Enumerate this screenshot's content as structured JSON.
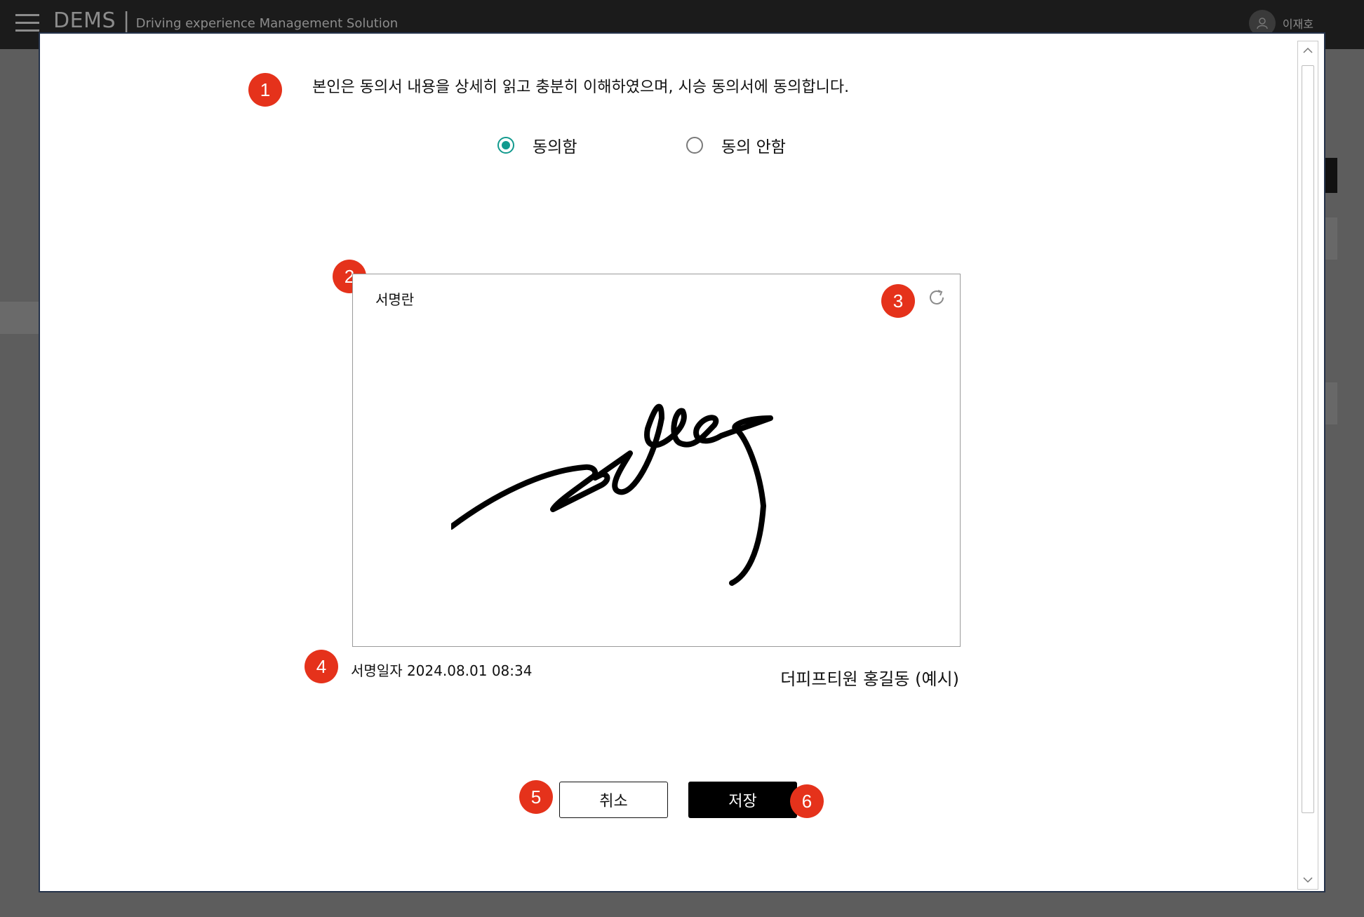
{
  "header": {
    "brand": "DEMS |",
    "brand_sub": "Driving experience Management Solution",
    "user_name": "이재호"
  },
  "modal": {
    "consent_text": "본인은 동의서 내용을 상세히 읽고 충분히 이해하였으며,  시승 동의서에 동의합니다.",
    "radio_agree": "동의함",
    "radio_disagree": "동의 안함",
    "selected": "agree",
    "signature_label": "서명란",
    "signature_date": "서명일자 2024.08.01  08:34",
    "signer": "더피프티원 홍길동 (예시)",
    "cancel_label": "취소",
    "save_label": "저장"
  },
  "markers": [
    "1",
    "2",
    "3",
    "4",
    "5",
    "6"
  ],
  "colors": {
    "marker": "#e5321b",
    "radio_active": "#129a8e",
    "save_bg": "#000000"
  },
  "icons": [
    "menu-icon",
    "user-icon",
    "refresh-icon",
    "chevron-up-icon",
    "chevron-down-icon"
  ]
}
